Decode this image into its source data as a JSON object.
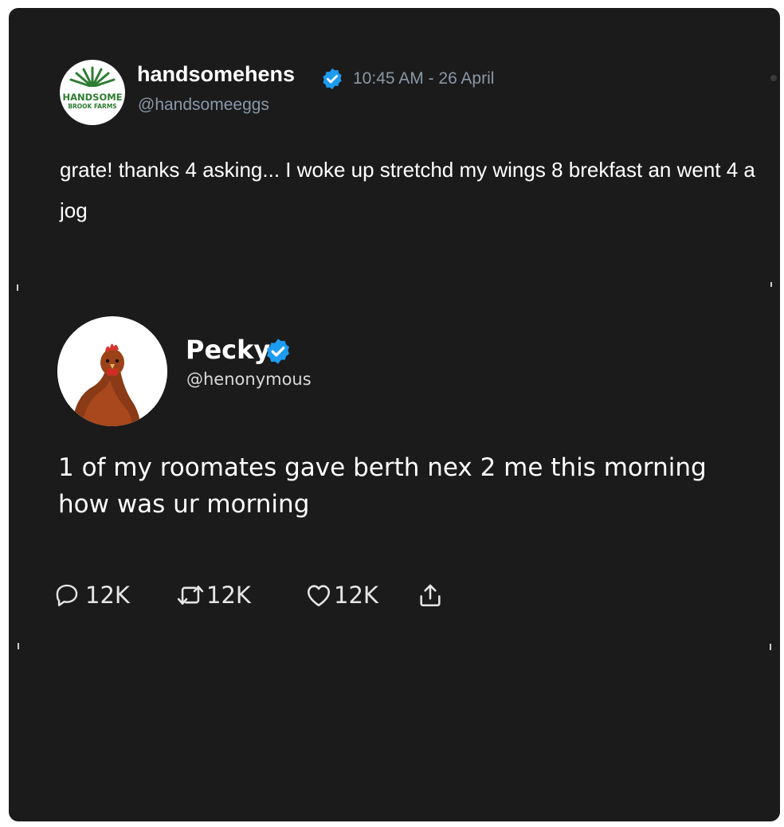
{
  "tweet1": {
    "avatar": {
      "logo_line1": "HANDSOME",
      "logo_line2": "BROOK FARMS",
      "icon": "farm-logo-icon"
    },
    "display_name": "handsomehens",
    "verified": true,
    "timestamp": "10:45 AM - 26 April",
    "handle": "@handsomeeggs",
    "text": "grate! thanks 4 asking... I woke up stretchd my wings 8 brekfast an went 4 a jog"
  },
  "tweet2": {
    "avatar": {
      "icon": "hen-avatar-icon"
    },
    "display_name": "Pecky",
    "verified": true,
    "handle": "@henonymous",
    "text": "1 of my roomates gave berth nex 2 me this morning how was ur morning",
    "actions": {
      "reply": {
        "icon": "reply-icon",
        "count": "12K"
      },
      "retweet": {
        "icon": "retweet-icon",
        "count": "12K"
      },
      "like": {
        "icon": "heart-icon",
        "count": "12K"
      },
      "share": {
        "icon": "share-icon"
      }
    }
  },
  "colors": {
    "background": "#1b1b1c",
    "verified": "#1d9bf0",
    "muted_text": "#8b98a5",
    "logo_green": "#2e7d32"
  }
}
